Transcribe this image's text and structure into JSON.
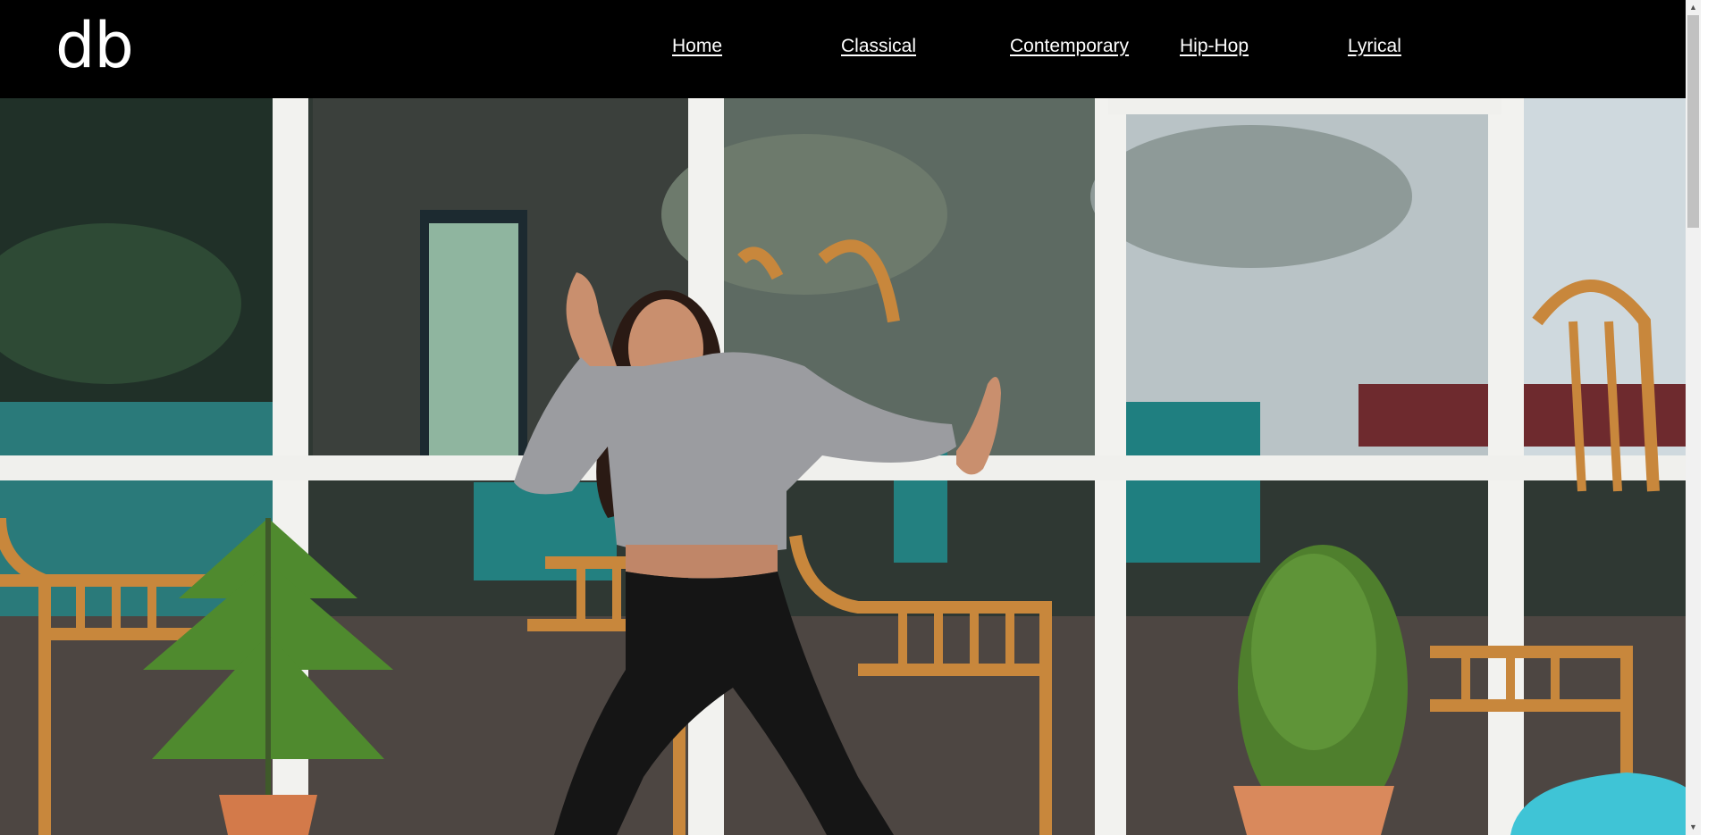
{
  "header": {
    "logo": "db",
    "nav": [
      {
        "label": "Home"
      },
      {
        "label": "Classical"
      },
      {
        "label": "Contemporary"
      },
      {
        "label": "Hip-Hop"
      },
      {
        "label": "Lyrical"
      }
    ]
  },
  "hero": {
    "image": "dancer-photo"
  },
  "scrollbar": {
    "up_icon": "▲",
    "down_icon": "▼"
  }
}
